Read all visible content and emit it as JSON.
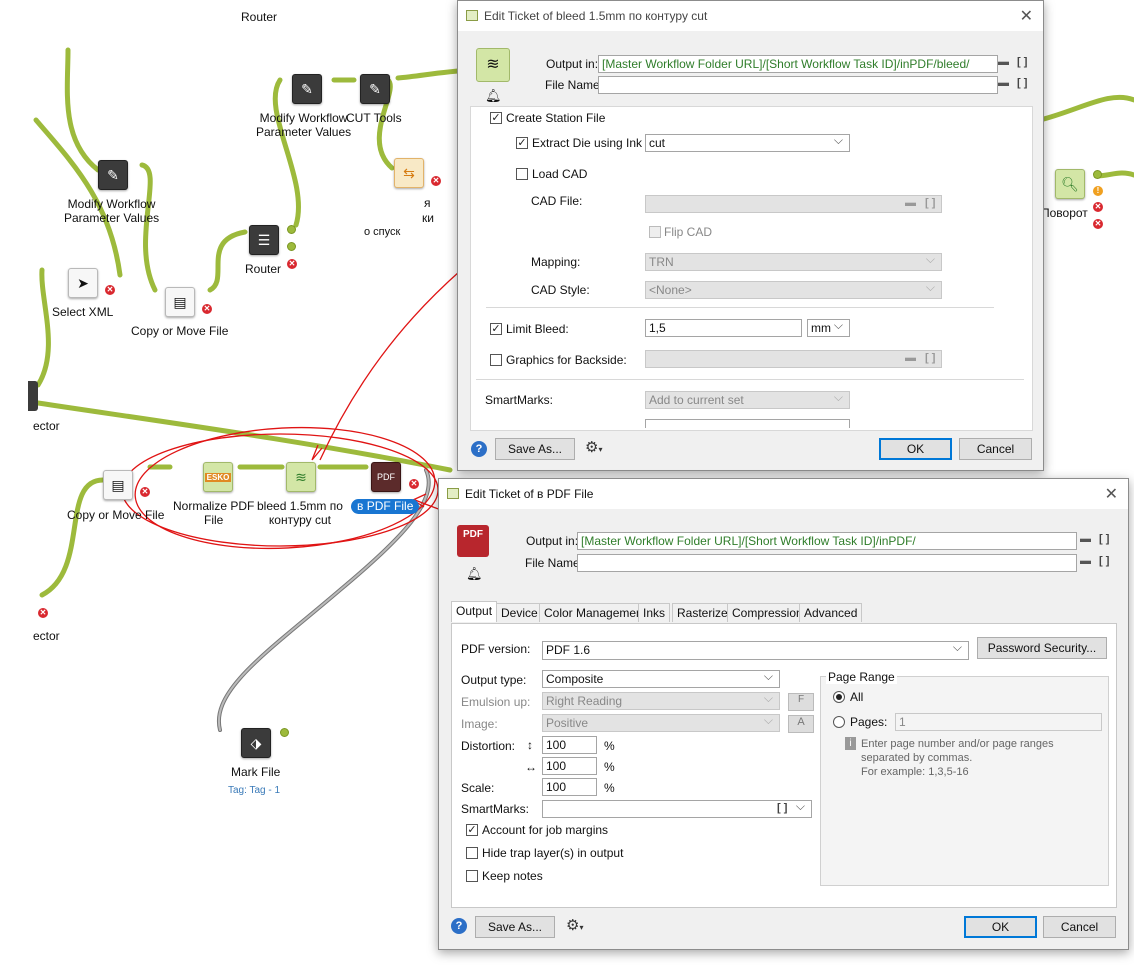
{
  "canvas": {
    "nodes": {
      "router_top": "Router",
      "modify1": "Modify Workflow\nParameter Values",
      "modify2": "Modify Workflow\nParameter Values",
      "cut_tools": "CUT Tools",
      "router_mid": "Router",
      "select_xml": "Select XML",
      "copy_move_1": "Copy or Move File",
      "connector_1": "ector",
      "copy_move_2": "Copy or Move File",
      "normalize": "Normalize PDF\nFile",
      "bleed": "bleed 1.5mm по\nконтуру cut",
      "to_pdf": "в PDF File",
      "connector_2": "ector",
      "mark_file": "Mark File",
      "mark_tag": "Tag: Tag - 1",
      "rotate": "Поворот",
      "partial_1": "я",
      "partial_2": "ки",
      "partial_3": "о      спуск"
    },
    "colors": {
      "connector": "#9dba3c",
      "annotation": "#e01414",
      "tag": "#1976d2"
    }
  },
  "dialog_bleed": {
    "title": "Edit Ticket of bleed 1.5mm по контуру cut",
    "output_label": "Output in:",
    "output_value": "[Master Workflow Folder URL]/[Short Workflow Task ID]/inPDF/bleed/",
    "file_name_label": "File Name:",
    "file_name_value": "",
    "create_station": "Create Station File",
    "extract_die": "Extract Die using Ink",
    "extract_die_value": "cut",
    "load_cad": "Load CAD",
    "cad_file_label": "CAD File:",
    "flip_cad": "Flip CAD",
    "mapping_label": "Mapping:",
    "mapping_value": "TRN",
    "cad_style_label": "CAD Style:",
    "cad_style_value": "<None>",
    "limit_bleed": "Limit Bleed:",
    "limit_bleed_value": "1,5",
    "limit_bleed_unit": "mm",
    "graphics_backside": "Graphics for Backside:",
    "smartmarks_label": "SmartMarks:",
    "smartmarks_value": "Add to current set",
    "save_as": "Save As...",
    "ok": "OK",
    "cancel": "Cancel"
  },
  "dialog_pdf": {
    "title": "Edit Ticket of в PDF File",
    "output_label": "Output in:",
    "output_value": "[Master Workflow Folder URL]/[Short Workflow Task ID]/inPDF/",
    "file_name_label": "File Name:",
    "file_name_value": "",
    "tabs": [
      "Output",
      "Device",
      "Color Management",
      "Inks",
      "Rasterize",
      "Compression",
      "Advanced"
    ],
    "pdf_version_label": "PDF version:",
    "pdf_version_value": "PDF 1.6",
    "password_security": "Password Security...",
    "output_type_label": "Output type:",
    "output_type_value": "Composite",
    "emulsion_label": "Emulsion up:",
    "emulsion_value": "Right Reading",
    "image_label": "Image:",
    "image_value": "Positive",
    "distortion_label": "Distortion:",
    "distortion_v": "100",
    "distortion_h": "100",
    "scale_label": "Scale:",
    "scale_value": "100",
    "percent": "%",
    "smartmarks_label": "SmartMarks:",
    "smartmarks_value": "",
    "account_margins": "Account for job margins",
    "hide_trap": "Hide trap layer(s) in output",
    "keep_notes": "Keep notes",
    "page_range_title": "Page Range",
    "all_label": "All",
    "pages_label": "Pages:",
    "pages_value": "1",
    "hint_line1": "Enter page number and/or page ranges",
    "hint_line2": "separated by commas.",
    "hint_line3": "For example: 1,3,5-16",
    "save_as": "Save As...",
    "ok": "OK",
    "cancel": "Cancel"
  }
}
